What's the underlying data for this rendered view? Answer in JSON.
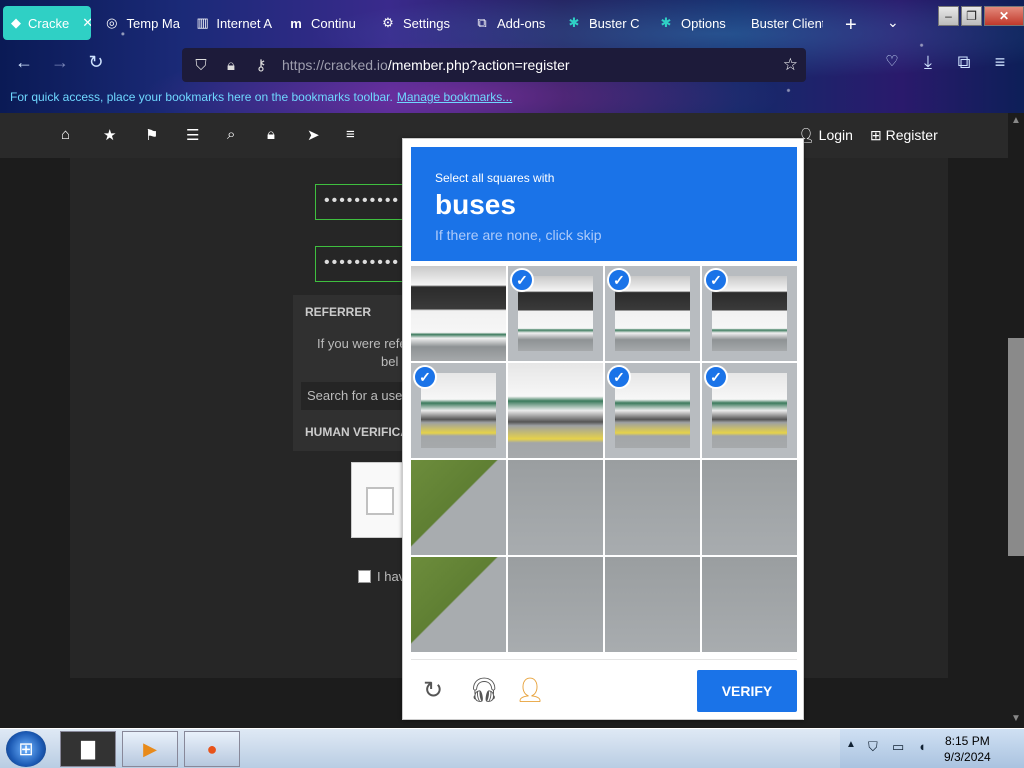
{
  "browser": {
    "tabs": [
      {
        "label": "Cracke",
        "icon": "cracked-icon",
        "active": true
      },
      {
        "label": "Temp Ma",
        "icon": "temp-mail-icon"
      },
      {
        "label": "Internet A",
        "icon": "archive-icon"
      },
      {
        "label": "Continu",
        "icon": "medium-icon"
      },
      {
        "label": "Settings",
        "icon": "gear-icon"
      },
      {
        "label": "Add-ons",
        "icon": "puzzle-icon"
      },
      {
        "label": "Buster C",
        "icon": "buster-icon"
      },
      {
        "label": "Options",
        "icon": "buster-icon"
      },
      {
        "label": "Buster Client",
        "icon": ""
      }
    ],
    "url_host": "https://cracked.io",
    "url_path": "/member.php?action=register",
    "bookmarks_message": "For quick access, place your bookmarks here on the bookmarks toolbar.",
    "bookmarks_link": "Manage bookmarks..."
  },
  "site": {
    "login": "Login",
    "register": "Register",
    "password_mask": "••••••••••",
    "referrer_heading": "REFERRER",
    "referrer_text_1": "If you were refe",
    "referrer_text_2": "bel",
    "referrer_search_placeholder": "Search for a use",
    "human_verification": "HUMAN VERIFICA",
    "agree_text": "I hav"
  },
  "captcha": {
    "instruction": "Select all squares with",
    "target": "buses",
    "hint": "If there are none, click skip",
    "verify": "VERIFY",
    "tiles": [
      {
        "kind": "bus",
        "selected": false
      },
      {
        "kind": "bus",
        "selected": true
      },
      {
        "kind": "bus",
        "selected": true
      },
      {
        "kind": "bus",
        "selected": true
      },
      {
        "kind": "bus2",
        "selected": true
      },
      {
        "kind": "bus2",
        "selected": false
      },
      {
        "kind": "bus2",
        "selected": true
      },
      {
        "kind": "bus2",
        "selected": true
      },
      {
        "kind": "grass",
        "selected": false
      },
      {
        "kind": "road",
        "selected": false
      },
      {
        "kind": "road",
        "selected": false
      },
      {
        "kind": "road",
        "selected": false
      },
      {
        "kind": "grass",
        "selected": false
      },
      {
        "kind": "road",
        "selected": false
      },
      {
        "kind": "road",
        "selected": false
      },
      {
        "kind": "road",
        "selected": false
      }
    ]
  },
  "taskbar": {
    "time": "8:15 PM",
    "date": "9/3/2024"
  }
}
